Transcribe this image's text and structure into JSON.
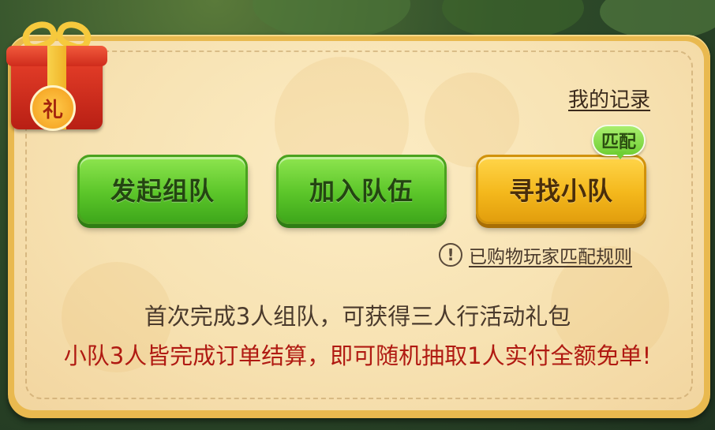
{
  "header": {
    "record_link": "我的记录"
  },
  "gift": {
    "badge_text": "礼",
    "icon": "gift-box-icon"
  },
  "buttons": [
    {
      "label": "发起组队",
      "style": "green"
    },
    {
      "label": "加入队伍",
      "style": "green"
    },
    {
      "label": "寻找小队",
      "style": "gold"
    }
  ],
  "match_badge": "匹配",
  "info": {
    "icon": "exclamation-circle-icon",
    "link": "已购物玩家匹配规则"
  },
  "description": {
    "line1": "首次完成3人组队，可获得三人行活动礼包",
    "line2": "小队3人皆完成订单结算，即可随机抽取1人实付全额免单!"
  },
  "colors": {
    "green_button": "#5cc62a",
    "gold_button": "#f4b81c",
    "highlight_text": "#b01a12",
    "panel_frame": "#e9b94f"
  }
}
